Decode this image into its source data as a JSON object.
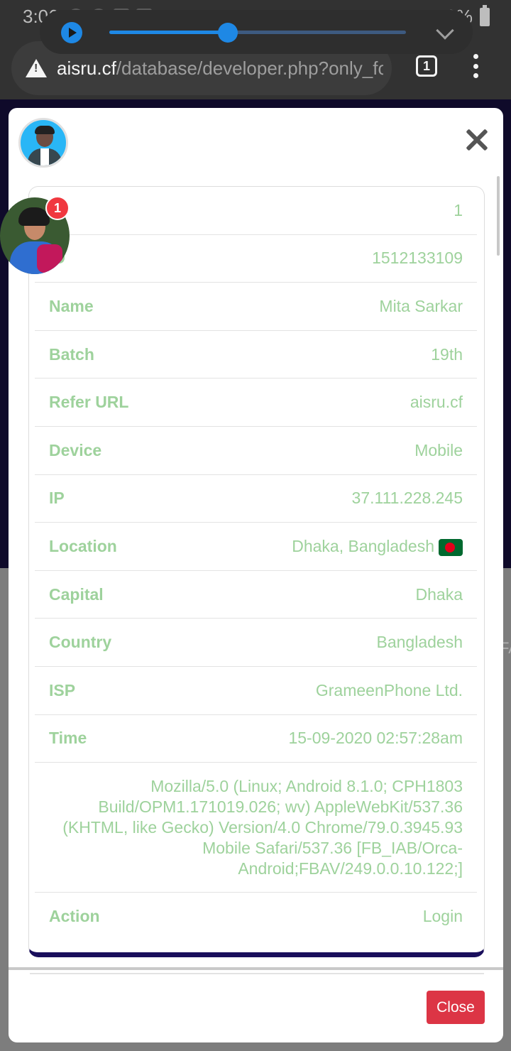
{
  "status_bar": {
    "time": "3:06",
    "battery": "79%"
  },
  "browser": {
    "url_host": "aisru.cf",
    "url_path": "/database/developer.php?only_for",
    "tab_count": "1"
  },
  "media_player": {
    "progress": 0.4
  },
  "chat_head": {
    "badge": "1"
  },
  "modal": {
    "rows": [
      {
        "label": "",
        "value": "1"
      },
      {
        "label": "ID",
        "value": "1512133109"
      },
      {
        "label": "Name",
        "value": "Mita Sarkar"
      },
      {
        "label": "Batch",
        "value": "19th"
      },
      {
        "label": "Refer URL",
        "value": "aisru.cf"
      },
      {
        "label": "Device",
        "value": "Mobile"
      },
      {
        "label": "IP",
        "value": "37.111.228.245"
      },
      {
        "label": "Location",
        "value": "Dhaka, Bangladesh"
      },
      {
        "label": "Capital",
        "value": "Dhaka"
      },
      {
        "label": "Country",
        "value": "Bangladesh"
      },
      {
        "label": "ISP",
        "value": "GrameenPhone Ltd."
      },
      {
        "label": "Time",
        "value": "15-09-2020 02:57:28am"
      }
    ],
    "user_agent": "Mozilla/5.0 (Linux; Android 8.1.0; CPH1803 Build/OPM1.171019.026; wv) AppleWebKit/537.36 (KHTML, like Gecko) Version/4.0 Chrome/79.0.3945.93 Mobile Safari/537.36 [FB_IAB/Orca-Android;FBAV/249.0.0.10.122;]",
    "action_label": "Action",
    "action_value": "Login",
    "close_button": "Close"
  },
  "page_edge_text": "FA",
  "colors": {
    "text_green": "#9ed29c",
    "close_red": "#dc3545",
    "card_border": "#1a0f5c",
    "media_blue": "#1e88e5"
  }
}
